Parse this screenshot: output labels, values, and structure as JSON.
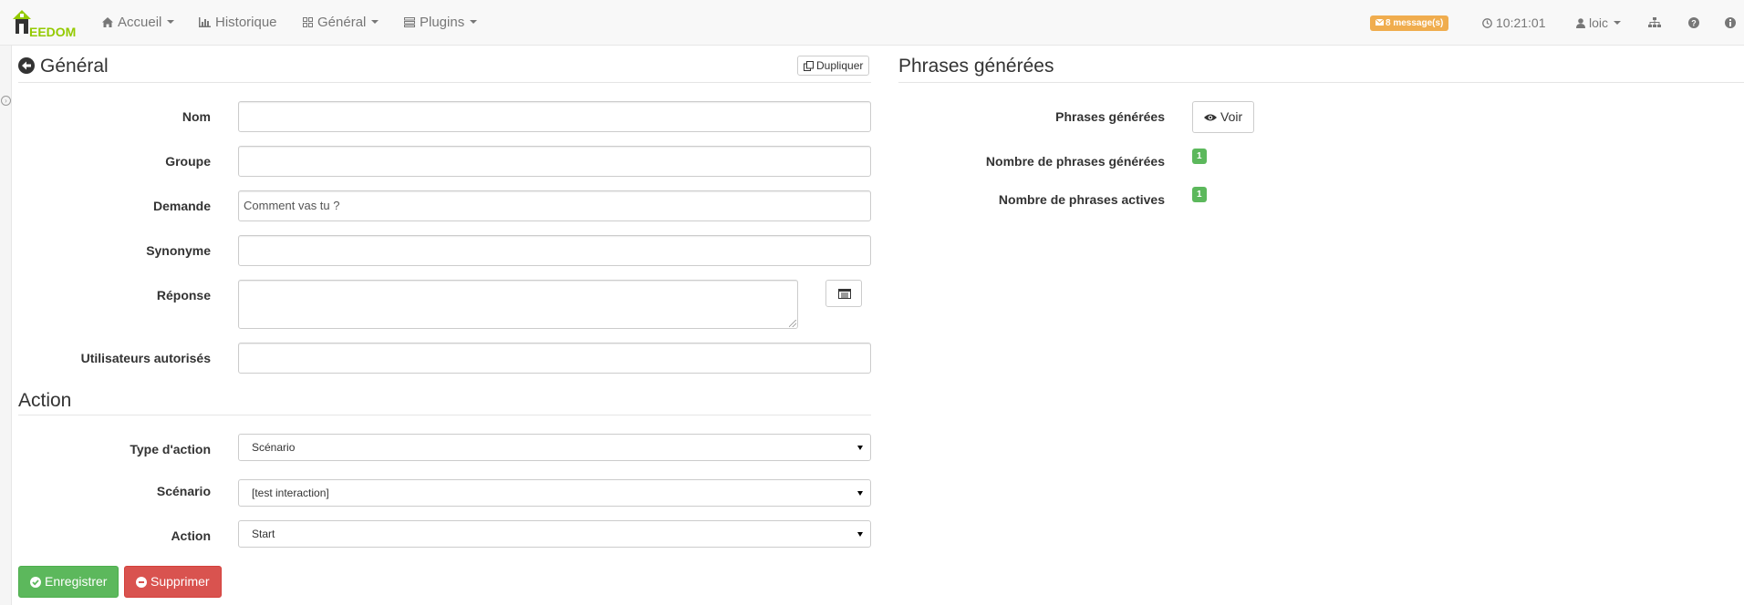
{
  "navbar": {
    "brand": "EEDOM",
    "items": [
      {
        "label": "Accueil",
        "icon": "home-icon"
      },
      {
        "label": "Historique",
        "icon": "bar-chart-icon"
      },
      {
        "label": "Général",
        "icon": "grid-icon"
      },
      {
        "label": "Plugins",
        "icon": "tasks-icon"
      }
    ],
    "messages": "8 message(s)",
    "time": "10:21:01",
    "user": "loic",
    "colors": {
      "accent": "#94ca02",
      "warning": "#f0ad4e"
    }
  },
  "general": {
    "title": "Général",
    "duplicate_label": "Dupliquer",
    "fields": {
      "nom": {
        "label": "Nom",
        "value": ""
      },
      "groupe": {
        "label": "Groupe",
        "value": ""
      },
      "demande": {
        "label": "Demande",
        "value": "Comment vas tu ?"
      },
      "synonyme": {
        "label": "Synonyme",
        "value": ""
      },
      "reponse": {
        "label": "Réponse",
        "value": ""
      },
      "utilisateurs": {
        "label": "Utilisateurs autorisés",
        "value": ""
      }
    }
  },
  "action": {
    "title": "Action",
    "type_label": "Type d'action",
    "type_value": "Scénario",
    "scenario_label": "Scénario",
    "scenario_value": "[test interaction]",
    "action_label": "Action",
    "action_value": "Start"
  },
  "buttons": {
    "save": "Enregistrer",
    "delete": "Supprimer",
    "colors": {
      "save": "#5cb85c",
      "delete": "#d9534f"
    }
  },
  "phrases": {
    "title": "Phrases générées",
    "generated_label": "Phrases générées",
    "view_label": "Voir",
    "count_label": "Nombre de phrases générées",
    "count_value": "1",
    "active_label": "Nombre de phrases actives",
    "active_value": "1"
  }
}
